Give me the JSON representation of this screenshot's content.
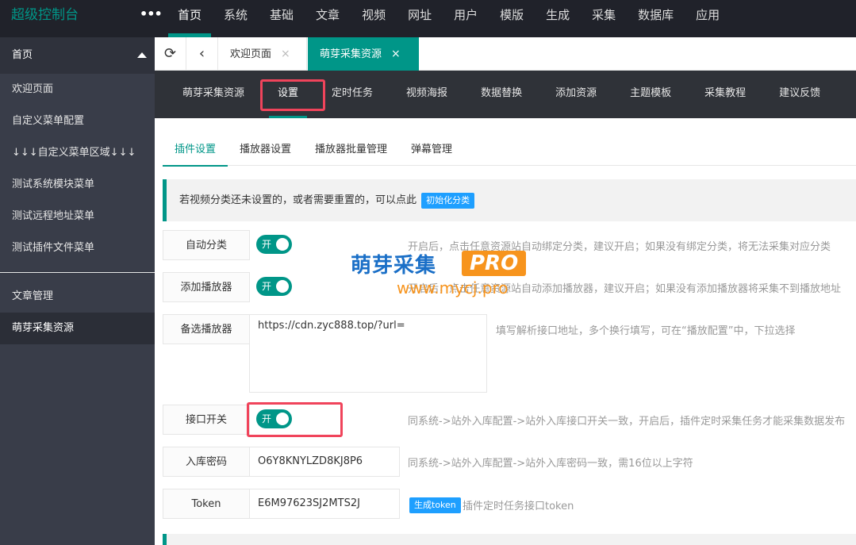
{
  "app": {
    "title": "超级控制台",
    "more_label": "•••"
  },
  "topnav": [
    "首页",
    "系统",
    "基础",
    "文章",
    "视频",
    "网址",
    "用户",
    "模版",
    "生成",
    "采集",
    "数据库",
    "应用"
  ],
  "sidebar": {
    "head": "首页",
    "group1": [
      "欢迎页面",
      "自定义菜单配置",
      "↓↓↓自定义菜单区域↓↓↓",
      "测试系统模块菜单",
      "测试远程地址菜单",
      "测试插件文件菜单"
    ],
    "group2": [
      "文章管理",
      "萌芽采集资源"
    ]
  },
  "tabbar": {
    "refresh_icon": "⟳",
    "back_icon": "‹",
    "tabs": [
      {
        "label": "欢迎页面",
        "close": "×"
      },
      {
        "label": "萌芽采集资源",
        "close": "×"
      }
    ]
  },
  "subnav": [
    "萌芽采集资源",
    "设置",
    "定时任务",
    "视频海报",
    "数据替换",
    "添加资源",
    "主题模板",
    "采集教程",
    "建议反馈"
  ],
  "content_tabs": [
    "插件设置",
    "播放器设置",
    "播放器批量管理",
    "弹幕管理"
  ],
  "notice": {
    "text": "若视频分类还未设置的，或者需要重置的，可以点此",
    "button": "初始化分类"
  },
  "settings": {
    "auto_category": {
      "label": "自动分类",
      "switch_text": "开",
      "hint": "开启后，点击任意资源站自动绑定分类，建议开启；如果没有绑定分类，将无法采集对应分类"
    },
    "add_player": {
      "label": "添加播放器",
      "switch_text": "开",
      "hint": "开启后，点击任意资源站自动添加播放器，建议开启；如果没有添加播放器将采集不到播放地址"
    },
    "backup_player": {
      "label": "备选播放器",
      "value": "https://cdn.zyc888.top/?url=",
      "hint": "填写解析接口地址，多个换行填写，可在“播放配置”中，下拉选择"
    },
    "api_switch": {
      "label": "接口开关",
      "switch_text": "开",
      "hint": "同系统->站外入库配置->站外入库接口开关一致，开启后，插件定时采集任务才能采集数据发布"
    },
    "ingest_password": {
      "label": "入库密码",
      "value": "O6Y8KNYLZD8KJ8P6",
      "hint": "同系统->站外入库配置->站外入库密码一致，需16位以上字符"
    },
    "token": {
      "label": "Token",
      "value": "E6M97623SJ2MTS2J",
      "button": "生成token",
      "hint": "插件定时任务接口token"
    }
  },
  "watermark": {
    "title": "萌芽采集",
    "pro": "PRO",
    "url": "www.mycj.pro"
  },
  "colors": {
    "accent": "#009688",
    "topbar": "#20222a",
    "sidebar": "#393d49",
    "highlight": "#f0445b",
    "blue_button": "#1e9fff"
  }
}
